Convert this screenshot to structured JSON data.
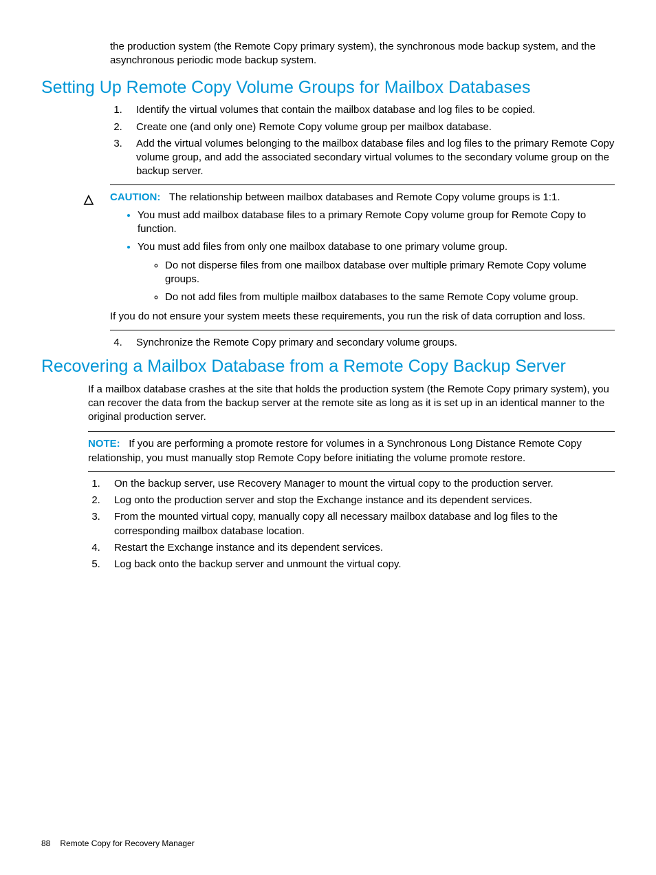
{
  "intro": "the production system (the Remote Copy primary system), the synchronous mode backup system, and the asynchronous periodic mode backup system.",
  "section1": {
    "heading": "Setting Up Remote Copy Volume Groups for Mailbox Databases",
    "steps": [
      "Identify the virtual volumes that contain the mailbox database and log files to be copied.",
      "Create one (and only one) Remote Copy volume group per mailbox database.",
      "Add the virtual volumes belonging to the mailbox database files and log files to the primary Remote Copy volume group, and add the associated secondary virtual volumes to the secondary volume group on the backup server."
    ],
    "caution": {
      "label": "CAUTION:",
      "lead": "The relationship between mailbox databases and Remote Copy volume groups is 1:1.",
      "bullets": [
        "You must add mailbox database files to a primary Remote Copy volume group for Remote Copy to function.",
        "You must add files from only one mailbox database to one primary volume group."
      ],
      "subbullets": [
        "Do not disperse files from one mailbox database over multiple primary Remote Copy volume groups.",
        "Do not add files from multiple mailbox databases to the same Remote Copy volume group."
      ],
      "trailing": "If you do not ensure your system meets these requirements, you run the risk of data corruption and loss."
    },
    "step4": "Synchronize the Remote Copy primary and secondary volume groups."
  },
  "section2": {
    "heading": "Recovering a Mailbox Database from a Remote Copy Backup Server",
    "para": "If a mailbox database crashes at the site that holds the production system (the Remote Copy primary system), you can recover the data from the backup server at the remote site as long as it is set up in an identical manner to the original production server.",
    "note": {
      "label": "NOTE:",
      "text": "If you are performing a promote restore for volumes in a Synchronous Long Distance Remote Copy relationship, you must manually stop Remote Copy before initiating the volume promote restore."
    },
    "steps": [
      "On the backup server, use Recovery Manager to mount the virtual copy to the production server.",
      "Log onto the production server and stop the Exchange instance and its dependent services.",
      "From the mounted virtual copy, manually copy all necessary mailbox database and log files to the corresponding mailbox database location.",
      "Restart the Exchange instance and its dependent services.",
      "Log back onto the backup server and unmount the virtual copy."
    ]
  },
  "footer": {
    "page": "88",
    "title": "Remote Copy for Recovery Manager"
  }
}
